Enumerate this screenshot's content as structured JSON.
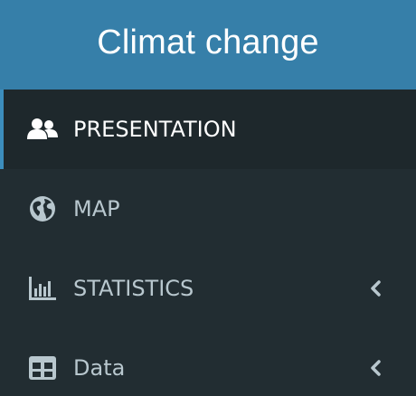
{
  "header": {
    "title": "Climat change"
  },
  "menu": {
    "items": [
      {
        "label": "PRESENTATION",
        "icon": "users-icon",
        "active": true
      },
      {
        "label": "MAP",
        "icon": "globe-icon",
        "active": false
      },
      {
        "label": "STATISTICS",
        "icon": "bar-chart-icon",
        "active": false,
        "expandable": true
      },
      {
        "label": "Data",
        "icon": "table-icon",
        "active": false,
        "expandable": true
      }
    ]
  },
  "colors": {
    "header_bg": "#367fa9",
    "sidebar_bg": "#222d32",
    "active_bg": "#1e282c",
    "active_border": "#3c8dbc",
    "text_muted": "#b8c7ce",
    "text_active": "#ffffff"
  }
}
